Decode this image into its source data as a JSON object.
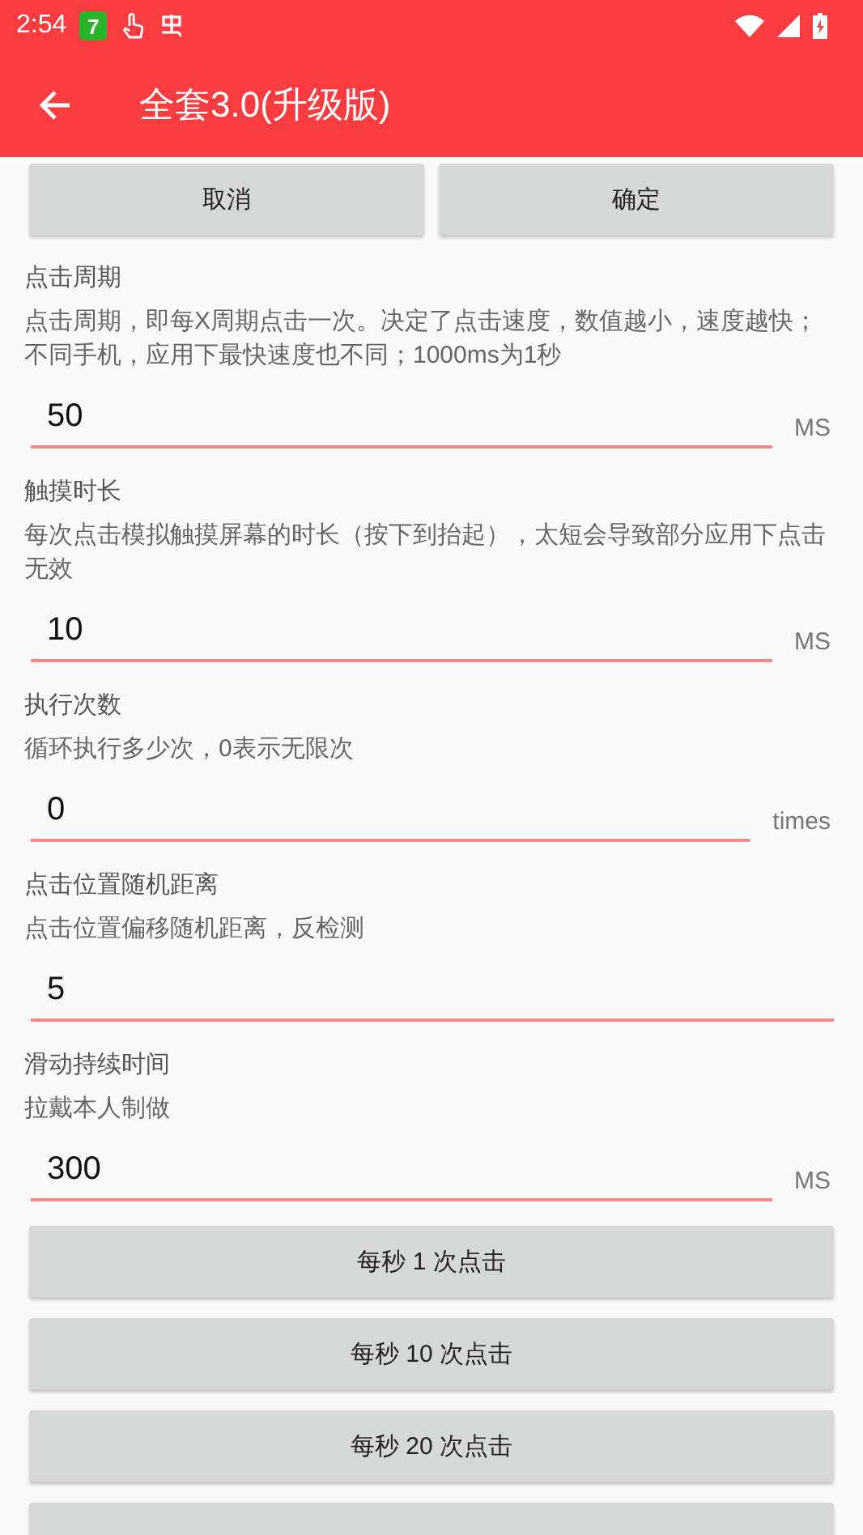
{
  "status_bar": {
    "time": "2:54",
    "badge": "7"
  },
  "toolbar": {
    "title": "全套3.0(升级版)"
  },
  "top_buttons": [
    "取消",
    "确定"
  ],
  "settings": [
    {
      "title": "点击周期",
      "description": "点击周期，即每X周期点击一次。决定了点击速度，数值越小，速度越快；不同手机，应用下最快速度也不同；1000ms为1秒",
      "value": "50",
      "unit": "MS"
    },
    {
      "title": "触摸时长",
      "description": "每次点击模拟触摸屏幕的时长（按下到抬起），太短会导致部分应用下点击无效",
      "value": "10",
      "unit": "MS"
    },
    {
      "title": "执行次数",
      "description": "循环执行多少次，0表示无限次",
      "value": "0",
      "unit": "times"
    },
    {
      "title": "点击位置随机距离",
      "description": "点击位置偏移随机距离，反检测",
      "value": "5"
    },
    {
      "title": "滑动持续时间",
      "description": "拉戴本人制做",
      "value": "300",
      "unit": "MS"
    }
  ],
  "preset_buttons": [
    "每秒 1 次点击",
    "每秒 10 次点击",
    "每秒 20 次点击"
  ]
}
